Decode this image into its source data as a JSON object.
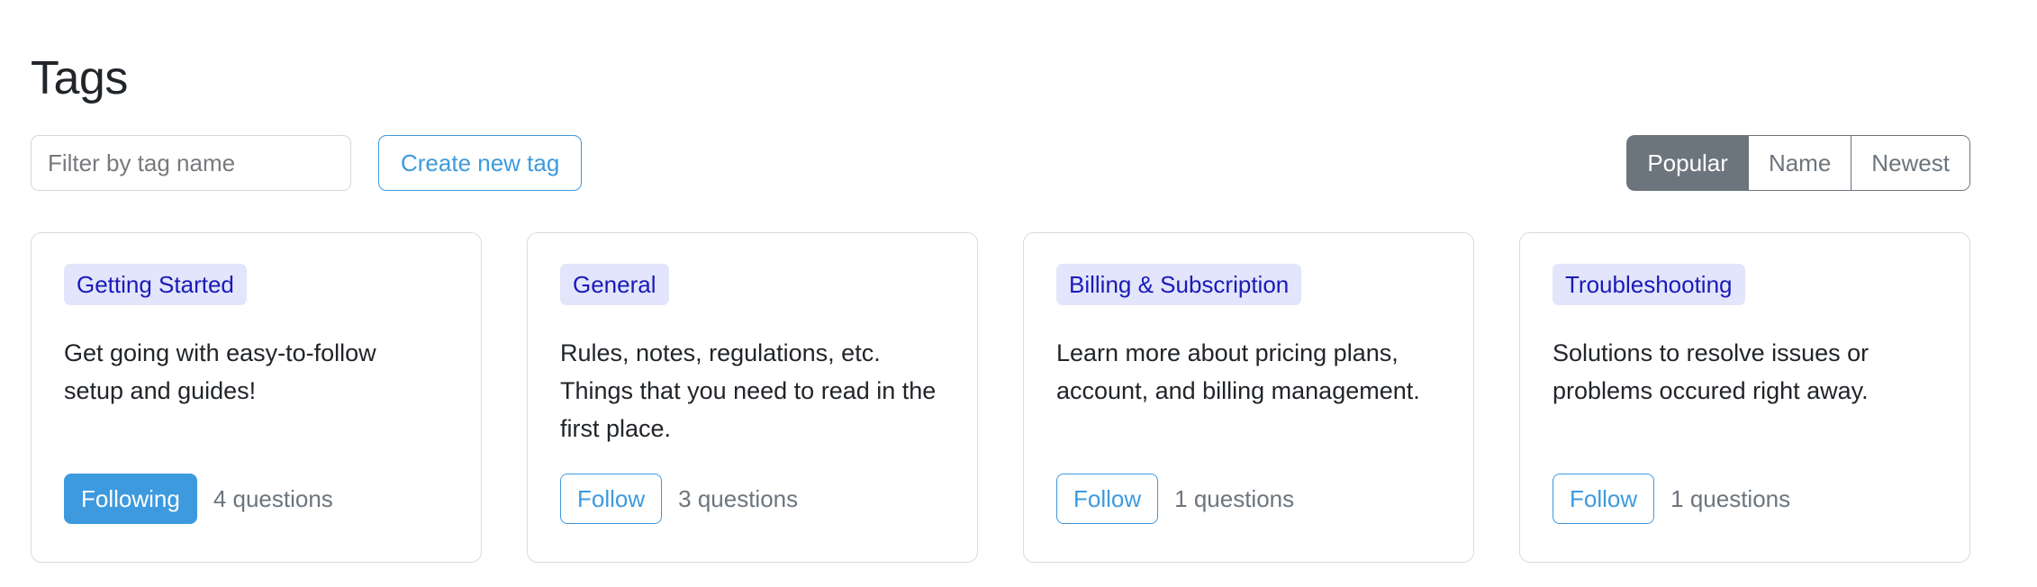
{
  "page": {
    "title": "Tags"
  },
  "toolbar": {
    "filter_placeholder": "Filter by tag name",
    "filter_value": "",
    "create_label": "Create new tag",
    "sort": {
      "active": "Popular",
      "options": [
        {
          "label": "Popular",
          "active": true
        },
        {
          "label": "Name",
          "active": false
        },
        {
          "label": "Newest",
          "active": false
        }
      ]
    }
  },
  "colors": {
    "accent_blue": "#3d9ade",
    "badge_bg": "#e2e5fb",
    "badge_text": "#1a1ab8",
    "slate": "#6c757d",
    "card_border": "#d9dbde",
    "text": "#212529"
  },
  "cards": [
    {
      "tag": "Getting Started",
      "description": "Get going with easy-to-follow setup and guides!",
      "follow_label": "Following",
      "following": true,
      "questions": "4 questions"
    },
    {
      "tag": "General",
      "description": "Rules, notes, regulations, etc. Things that you need to read in the first place.",
      "follow_label": "Follow",
      "following": false,
      "questions": "3 questions"
    },
    {
      "tag": "Billing & Subscription",
      "description": "Learn more about pricing plans, account, and billing management.",
      "follow_label": "Follow",
      "following": false,
      "questions": "1 questions"
    },
    {
      "tag": "Troubleshooting",
      "description": "Solutions to resolve issues or problems occured right away.",
      "follow_label": "Follow",
      "following": false,
      "questions": "1 questions"
    }
  ]
}
